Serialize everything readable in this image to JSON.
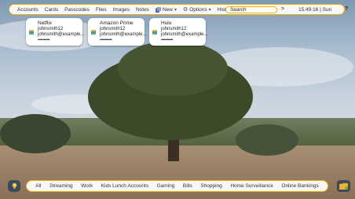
{
  "nav": {
    "items": [
      "Accounts",
      "Cards",
      "Passcodes",
      "Files",
      "Images",
      "Notes"
    ],
    "new_label": "New",
    "options_label": "Options",
    "history_label": "History",
    "search_placeholder": "Search",
    "go_label": ">",
    "clock": "15:49:16 | Sun",
    "help_label": "?"
  },
  "cards": [
    {
      "name": "Netflix",
      "username": "johnsmith12",
      "email": "johnsmith@example...",
      "password": "••••••••••••"
    },
    {
      "name": "Amazon Prime",
      "username": "johnsmith12",
      "email": "johnsmith@example...",
      "password": "••••••••••••"
    },
    {
      "name": "Hulu",
      "username": "johnsmith12",
      "email": "johnsmith@example...",
      "password": "••••••••••••"
    }
  ],
  "categories": [
    "All",
    "Streaming",
    "Work",
    "Kids Lunch Accounts",
    "Gaming",
    "Bills",
    "Shopping",
    "Home Surveillance",
    "Online Bankings"
  ],
  "colors": {
    "accent": "#f0b000",
    "button_bg": "#3b4a5c",
    "bar_bg": "#f7f7f7"
  }
}
